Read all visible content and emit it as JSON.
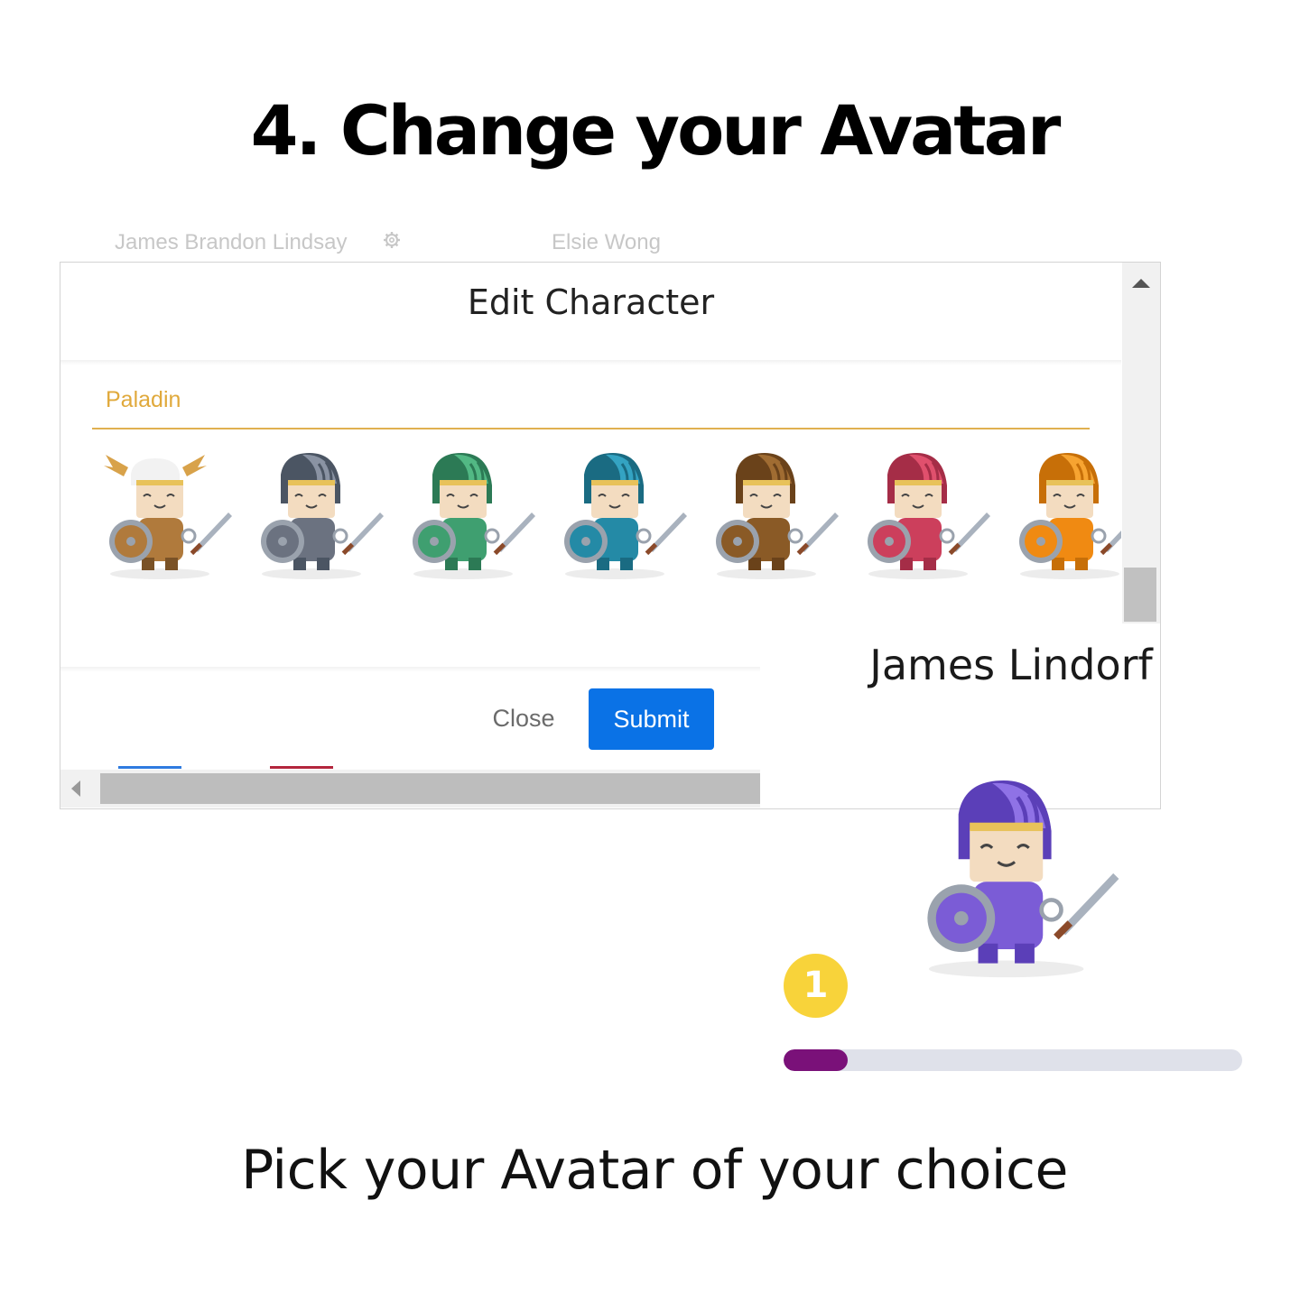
{
  "heading": "4. Change your Avatar",
  "background_names": [
    "James Brandon Lindsay",
    "Elsie Wong"
  ],
  "modal": {
    "title": "Edit Character",
    "class_tab": "Paladin",
    "avatars": [
      {
        "icon": "valkyrie-avatar-icon",
        "main": "#b07a3c",
        "dark": "#7a5226",
        "helmet": "#f2f2f2"
      },
      {
        "icon": "paladin-gray-avatar-icon",
        "main": "#6b7280",
        "dark": "#4b5563",
        "helmet": "#8a93a3"
      },
      {
        "icon": "paladin-green-avatar-icon",
        "main": "#3f9f70",
        "dark": "#2c7a55",
        "helmet": "#52b884"
      },
      {
        "icon": "paladin-teal-avatar-icon",
        "main": "#248aa6",
        "dark": "#1a6b82",
        "helmet": "#34a3c2"
      },
      {
        "icon": "paladin-brown-avatar-icon",
        "main": "#8a5a26",
        "dark": "#6a421a",
        "helmet": "#a06c32"
      },
      {
        "icon": "paladin-red-avatar-icon",
        "main": "#cc3f5c",
        "dark": "#a52d47",
        "helmet": "#e0506d"
      },
      {
        "icon": "paladin-orange-avatar-icon",
        "main": "#f08a12",
        "dark": "#c76f08",
        "helmet": "#f7a431"
      }
    ],
    "close_label": "Close",
    "submit_label": "Submit"
  },
  "profile": {
    "name": "James Lindorf",
    "avatar": {
      "icon": "paladin-purple-avatar-icon",
      "main": "#7b5cd6",
      "dark": "#5b3fb8",
      "helmet": "#8f72e6"
    },
    "level": "1",
    "xp_fraction": 0.14,
    "colors": {
      "badge": "#f8d33a",
      "xp_fill": "#7a1179",
      "xp_track": "#dfe1ea"
    }
  },
  "caption": "Pick your Avatar of your choice"
}
